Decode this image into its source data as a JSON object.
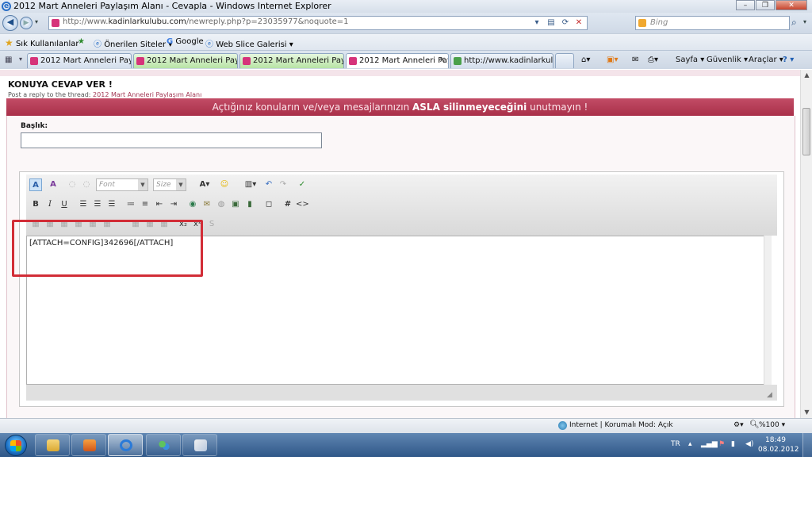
{
  "window": {
    "title": "2012 Mart Anneleri Paylaşım Alanı - Cevapla - Windows Internet Explorer",
    "controls": {
      "minimize": "–",
      "restore": "❐",
      "close": "✕"
    }
  },
  "address_bar": {
    "url_prefix": "http://www.",
    "url_domain": "kadinlarkulubu.com",
    "url_path": "/newreply.php?p=23035977&noquote=1",
    "search_placeholder": "Bing"
  },
  "favorites_bar": {
    "favorites_label": "Sık Kullanılanlar",
    "suggested_sites": "Önerilen Siteler ▾",
    "google": "Google",
    "web_slice": "Web Slice Galerisi ▾"
  },
  "tabs": [
    {
      "label": "2012 Mart Anneleri Paylaşı...",
      "state": "normal"
    },
    {
      "label": "2012 Mart Anneleri Paylaşı...",
      "state": "green"
    },
    {
      "label": "2012 Mart Anneleri Paylaşı...",
      "state": "green"
    },
    {
      "label": "2012 Mart Anneleri Paylaşı...",
      "state": "active"
    },
    {
      "label": "http://www.kadinlarkulubu...",
      "state": "normal"
    }
  ],
  "command_bar": {
    "page": "Sayfa ▾",
    "safety": "Güvenlik ▾",
    "tools": "Araçlar ▾",
    "help": "? ▾"
  },
  "page": {
    "heading": "KONUYA CEVAP VER !",
    "subheading_prefix": "Post a reply to the thread: ",
    "subheading_thread": "2012 Mart Anneleri Paylaşım Alanı",
    "banner_part1": "Açtığınız konuların ve/veya mesajlarınızın ",
    "banner_bold": "ASLA silinmeyeceğini",
    "banner_part2": " unutmayın !",
    "title_label": "Başlık:",
    "title_value": "",
    "editor": {
      "font_placeholder": "Font",
      "size_placeholder": "Size",
      "content": "[ATTACH=CONFIG]342696[/ATTACH]"
    }
  },
  "status_bar": {
    "zone": "Internet | Korumalı Mod: Açık",
    "zoom": "%100 ▾"
  },
  "taskbar": {
    "language": "TR",
    "time": "18:49",
    "date": "08.02.2012"
  },
  "colors": {
    "banner": "#b23a53",
    "highlight_box": "#d22d37",
    "taskbar": "#4a72a2"
  }
}
